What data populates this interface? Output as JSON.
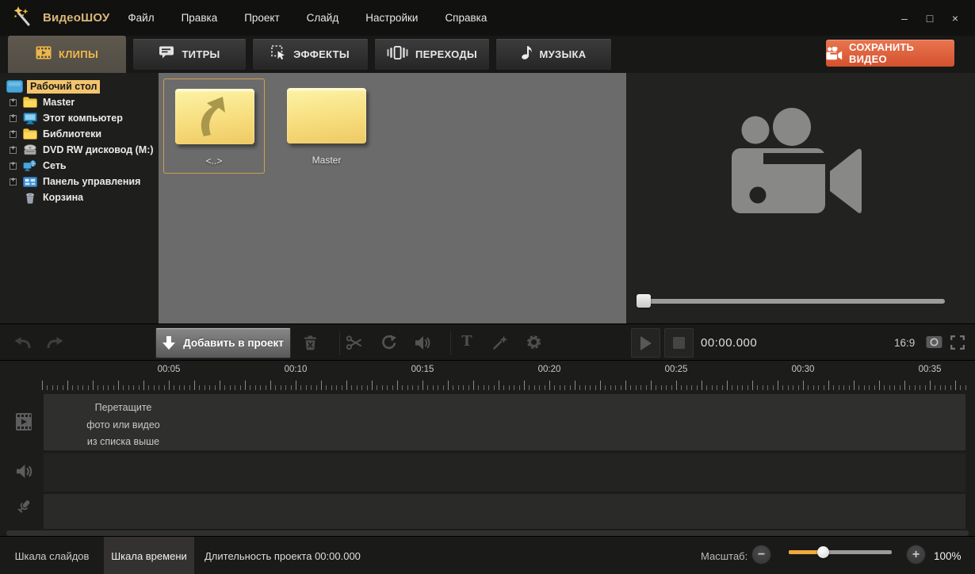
{
  "colors": {
    "accent_gold": "#f0b94a",
    "accent_orange": "#dd5b35",
    "folder_yellow": "#f7dd7d",
    "tree_selection": "#f2c46d"
  },
  "titlebar": {
    "app_title": "ВидеоШОУ",
    "menu_items": [
      "Файл",
      "Правка",
      "Проект",
      "Слайд",
      "Настройки",
      "Справка"
    ]
  },
  "glyphs": {
    "minimize": "–",
    "maximize": "□",
    "close": "×",
    "text_tool": "T",
    "zoom_minus": "−",
    "zoom_plus": "+"
  },
  "tabs": [
    {
      "label": "КЛИПЫ",
      "icon": "film-strip-icon",
      "active": true
    },
    {
      "label": "ТИТРЫ",
      "icon": "speech-bubble-icon",
      "active": false
    },
    {
      "label": "ЭФФЕКТЫ",
      "icon": "effects-icon",
      "active": false
    },
    {
      "label": "ПЕРЕХОДЫ",
      "icon": "transitions-icon",
      "active": false
    },
    {
      "label": "МУЗЫКА",
      "icon": "music-note-icon",
      "active": false
    }
  ],
  "save_button": {
    "label": "СОХРАНИТЬ ВИДЕО",
    "icon": "camcorder-icon"
  },
  "folder_tree": {
    "items": [
      {
        "label": "Рабочий стол",
        "icon": "desktop-icon",
        "selected": true,
        "expandable": false
      },
      {
        "label": "Master",
        "icon": "folder-icon",
        "selected": false,
        "expandable": true
      },
      {
        "label": "Этот компьютер",
        "icon": "computer-icon",
        "selected": false,
        "expandable": true
      },
      {
        "label": "Библиотеки",
        "icon": "folder-icon",
        "selected": false,
        "expandable": true
      },
      {
        "label": "DVD RW дисковод (M:)",
        "icon": "disc-drive-icon",
        "selected": false,
        "expandable": true
      },
      {
        "label": "Сеть",
        "icon": "network-icon",
        "selected": false,
        "expandable": true
      },
      {
        "label": "Панель управления",
        "icon": "control-panel-icon",
        "selected": false,
        "expandable": true
      },
      {
        "label": "Корзина",
        "icon": "recycle-bin-icon",
        "selected": false,
        "expandable": false
      }
    ]
  },
  "file_browser": {
    "items": [
      {
        "label": "<..>",
        "type": "parent-folder",
        "selected": true
      },
      {
        "label": "Master",
        "type": "folder",
        "selected": false
      }
    ]
  },
  "preview": {
    "time": "00:00.000",
    "aspect_ratio": "16:9",
    "seek_position_percent": 0
  },
  "toolbar": {
    "add_button_label": "Добавить в проект"
  },
  "timeline": {
    "ruler_labels": [
      "00:05",
      "00:10",
      "00:15",
      "00:20",
      "00:25",
      "00:30",
      "00:35"
    ],
    "drop_hint": [
      "Перетащите",
      "фото или видео",
      "из списка выше"
    ]
  },
  "statusbar": {
    "slides_tab": "Шкала слайдов",
    "time_tab": "Шкала времени",
    "duration": "Длительность проекта 00:00.000",
    "zoom_label": "Масштаб:",
    "zoom_percent": "100%"
  }
}
